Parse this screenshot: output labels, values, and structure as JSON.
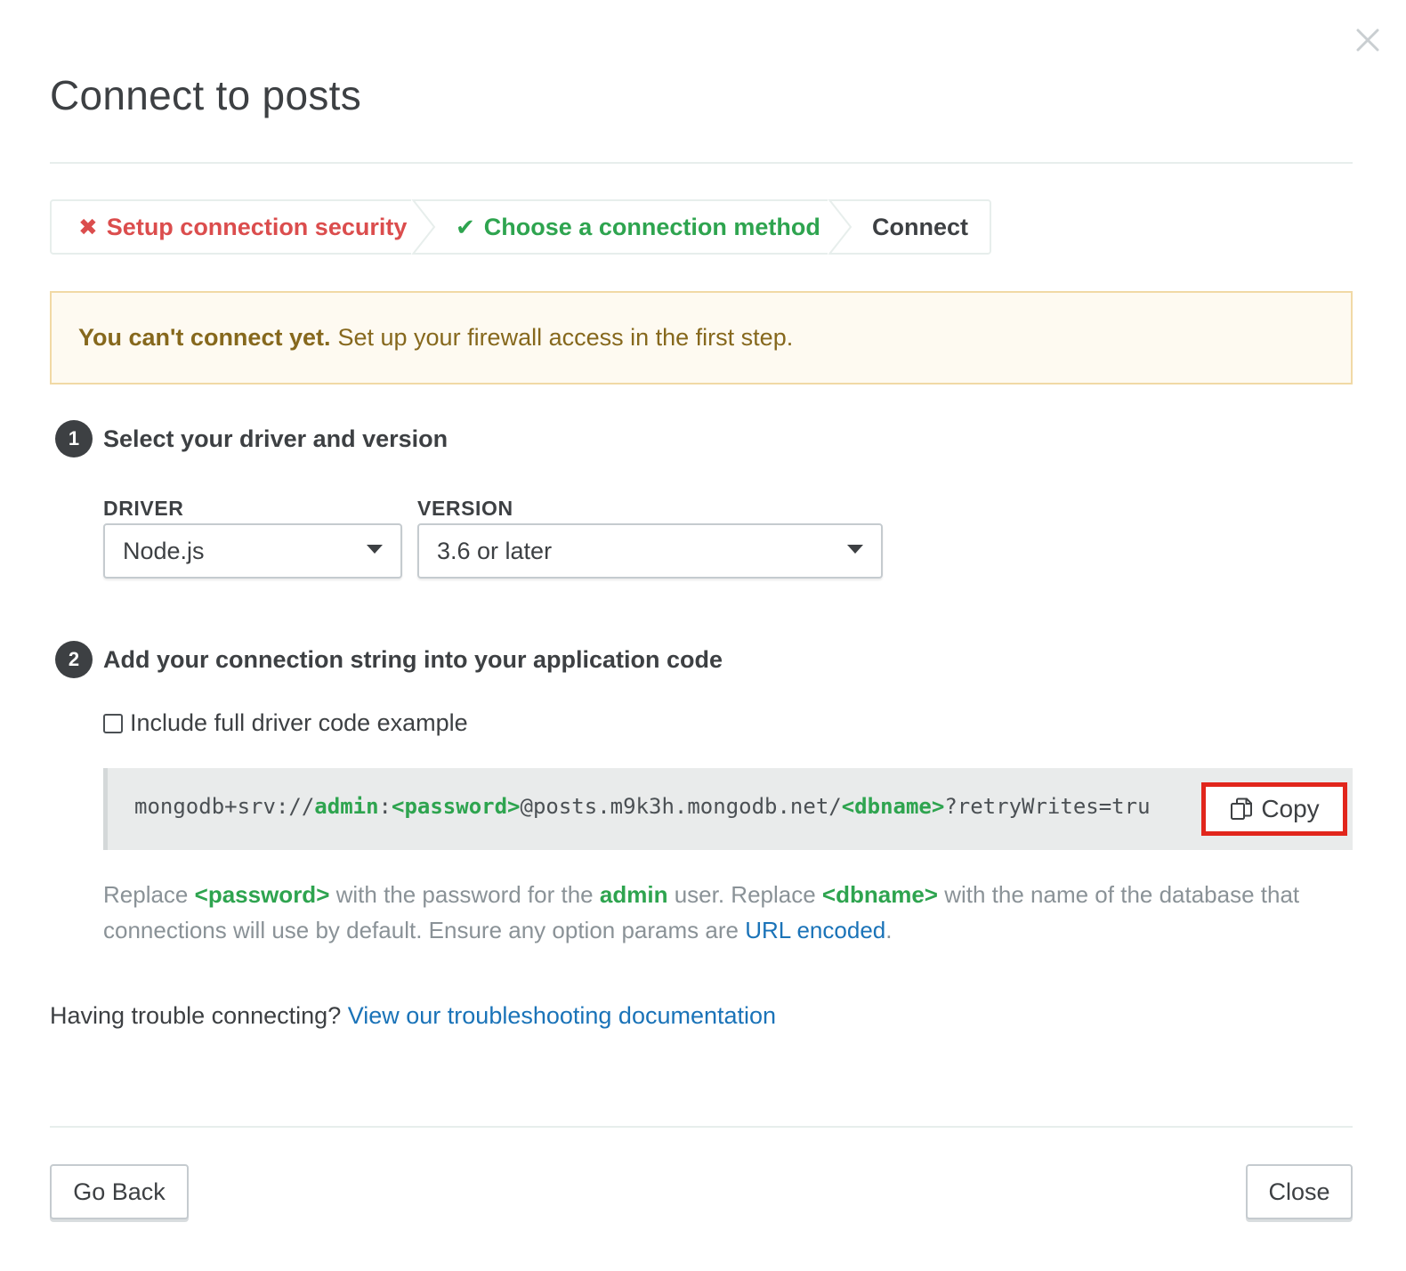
{
  "modal": {
    "title": "Connect to posts",
    "close_icon": "close-icon"
  },
  "steps": [
    {
      "icon": "x-icon",
      "glyph": "✖",
      "label": "Setup connection security",
      "state": "error",
      "color": "#db4d4d"
    },
    {
      "icon": "check-icon",
      "glyph": "✔",
      "label": "Choose a connection method",
      "state": "complete",
      "color": "#2ea44f"
    },
    {
      "label": "Connect",
      "state": "current"
    }
  ],
  "warning": {
    "bold": "You can't connect yet.",
    "text": "Set up your firewall access in the first step."
  },
  "section1": {
    "number": "1",
    "title": "Select your driver and version",
    "driver_label": "DRIVER",
    "driver_value": "Node.js",
    "version_label": "VERSION",
    "version_value": "3.6 or later"
  },
  "section2": {
    "number": "2",
    "title": "Add your connection string into your application code",
    "checkbox_label": "Include full driver code example",
    "checkbox_checked": false,
    "connection_string": {
      "p1": "mongodb+srv://",
      "user": "admin",
      "p2": ":",
      "password": "<password>",
      "p3": "@posts.m9k3h.mongodb.net/",
      "dbname": "<dbname>",
      "p4": "?retryWrites=tru"
    },
    "copy_label": "Copy",
    "help": {
      "t1": "Replace",
      "password": "<password>",
      "t2": "with the password for the",
      "user": "admin",
      "t3": "user. Replace",
      "dbname": "<dbname>",
      "t4": "with the name of the database that connections will use by default. Ensure any option params are",
      "link": "URL encoded",
      "t5": "."
    }
  },
  "trouble": {
    "text": "Having trouble connecting?",
    "link": "View our troubleshooting documentation"
  },
  "footer": {
    "back_label": "Go Back",
    "close_label": "Close"
  },
  "colors": {
    "error": "#db4d4d",
    "success": "#2ea44f",
    "link": "#1a73b8",
    "warning_text": "#86681d",
    "highlight": "#e1261c"
  }
}
